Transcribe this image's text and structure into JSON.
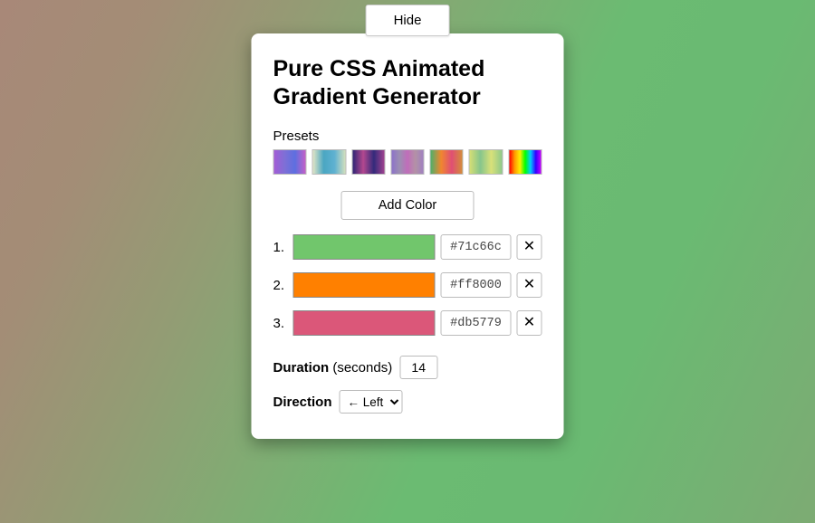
{
  "hide_button": "Hide",
  "title": "Pure CSS Animated Gradient Generator",
  "presets_label": "Presets",
  "add_color_label": "Add Color",
  "colors": [
    {
      "num": "1.",
      "hex": "#71c66c",
      "swatch": "#71c66c"
    },
    {
      "num": "2.",
      "hex": "#ff8000",
      "swatch": "#ff8000"
    },
    {
      "num": "3.",
      "hex": "#db5779",
      "swatch": "#db5779"
    }
  ],
  "remove_icon": "✕",
  "duration": {
    "label_bold": "Duration",
    "label_rest": " (seconds)",
    "value": "14"
  },
  "direction": {
    "label": "Direction",
    "selected": "← Left"
  }
}
